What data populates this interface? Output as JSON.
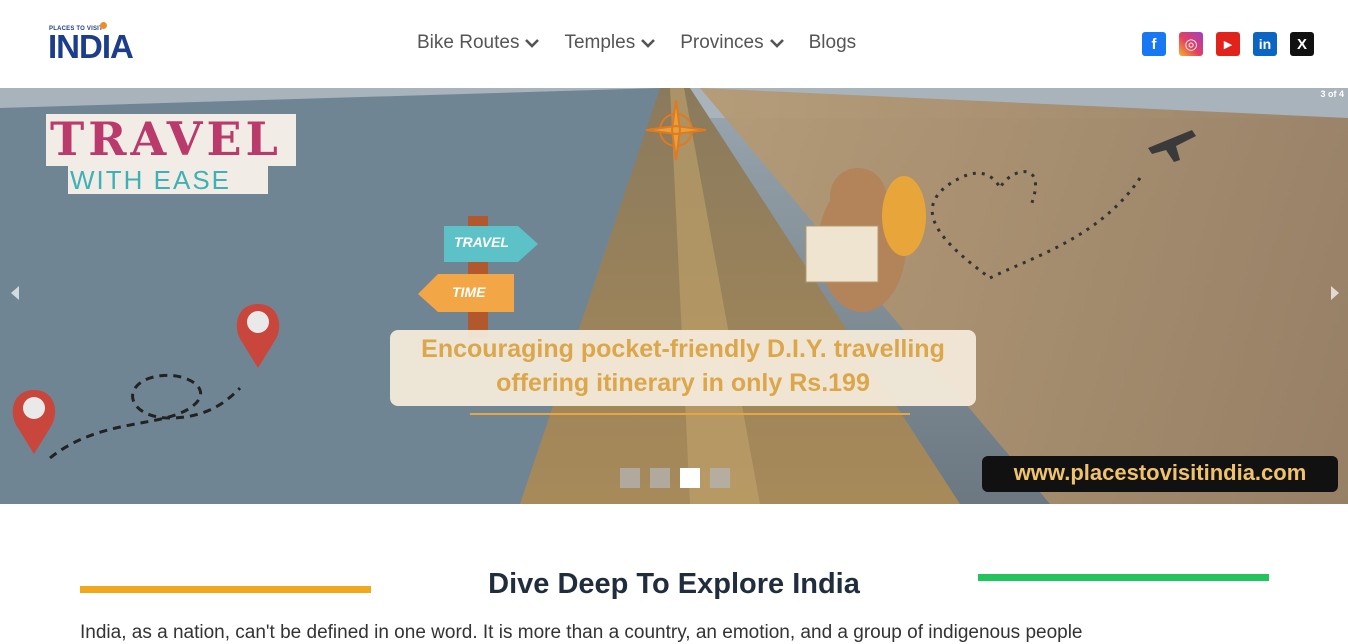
{
  "header": {
    "logo": {
      "small_text": "PLACES TO VISIT",
      "big_text": "INDIA"
    },
    "nav": [
      {
        "label": "Bike Routes",
        "has_dropdown": true
      },
      {
        "label": "Temples",
        "has_dropdown": true
      },
      {
        "label": "Provinces",
        "has_dropdown": true
      },
      {
        "label": "Blogs",
        "has_dropdown": false
      }
    ],
    "social": [
      {
        "name": "facebook-icon",
        "glyph": "f"
      },
      {
        "name": "instagram-icon",
        "glyph": "◎"
      },
      {
        "name": "youtube-icon",
        "glyph": "▶"
      },
      {
        "name": "linkedin-icon",
        "glyph": "in"
      },
      {
        "name": "x-icon",
        "glyph": "X"
      }
    ]
  },
  "carousel": {
    "counter": "3 of 4",
    "slide": {
      "badge_line1": "TRAVEL",
      "badge_line2": "WITH EASE",
      "sign_top": "TRAVEL",
      "sign_bottom": "TIME",
      "caption_line1": "Encouraging pocket-friendly D.I.Y. travelling",
      "caption_line2": "offering itinerary in only Rs.199",
      "website": "www.placestovisitindia.com"
    },
    "total_slides": 4,
    "active_index": 2
  },
  "section": {
    "title": "Dive Deep To Explore India",
    "intro": "India, as a nation, can't be defined in one word. It is more than a country, an emotion, and a group of indigenous people"
  },
  "colors": {
    "accent_orange": "#f2a81d",
    "accent_green": "#22c45e",
    "brand_blue": "#1c3d8c"
  }
}
